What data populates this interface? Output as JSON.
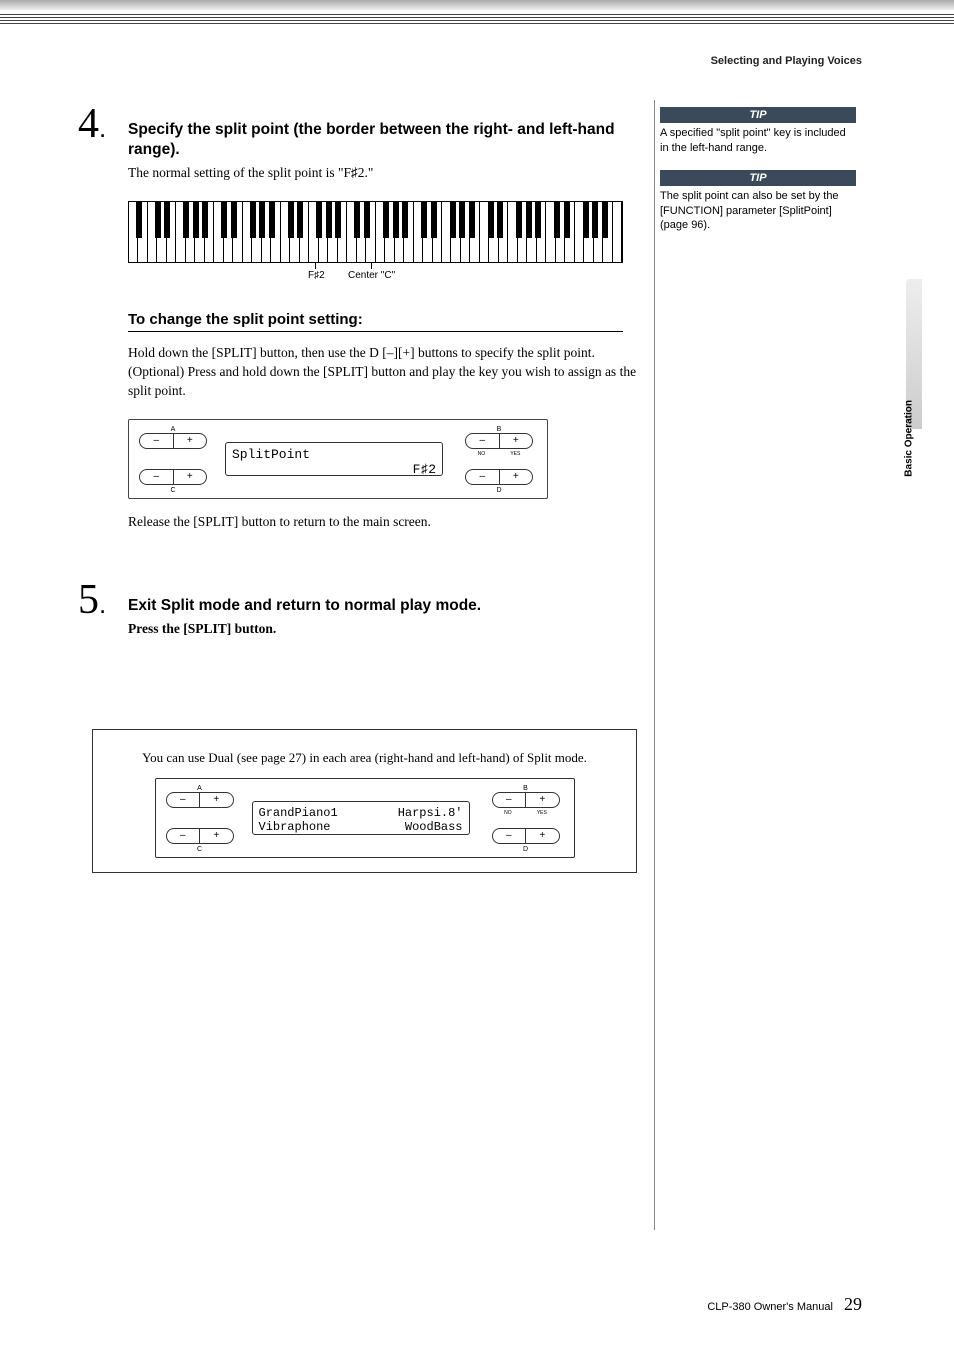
{
  "header": {
    "section": "Selecting and Playing Voices"
  },
  "step4": {
    "num": "4",
    "dot": ".",
    "title": "Specify the split point (the border between the right- and left-hand range).",
    "body": "The normal setting of the split point is \"F♯2.\"",
    "kb_label_fsharp": "F♯2",
    "kb_label_center": "Center \"C\""
  },
  "subheading": "To change the split point setting:",
  "change_body_1": "Hold down the [SPLIT] button, then use the D [–][+] buttons to specify the split point.",
  "change_body_2": "(Optional) Press and hold down the [SPLIT] button and play the key you wish to assign as the split point.",
  "panel1": {
    "label_a": "A",
    "label_b": "B",
    "label_c": "C",
    "label_d": "D",
    "label_no": "NO",
    "label_yes": "YES",
    "lcd_line1": "SplitPoint",
    "lcd_line2": "F♯2"
  },
  "release_text": "Release the [SPLIT] button to return to the main screen.",
  "step5": {
    "num": "5",
    "dot": ".",
    "title": "Exit Split mode and return to normal play mode.",
    "body": "Press the [SPLIT] button."
  },
  "boxed": {
    "text": "You can use Dual (see page 27) in each area (right-hand and left-hand) of Split mode.",
    "lcd_tl": "GrandPiano1",
    "lcd_tr": "Harpsi.8'",
    "lcd_bl": "Vibraphone",
    "lcd_br": "WoodBass"
  },
  "tips": {
    "tip_label": "TIP",
    "tip1": "A specified \"split point\" key is included in the left-hand range.",
    "tip2": "The split point can also be set by the [FUNCTION] parameter [SplitPoint] (page 96)."
  },
  "side_tab": "Basic Operation",
  "footer": {
    "manual": "CLP-380 Owner's Manual",
    "page": "29"
  },
  "minus": "–",
  "plus": "+"
}
